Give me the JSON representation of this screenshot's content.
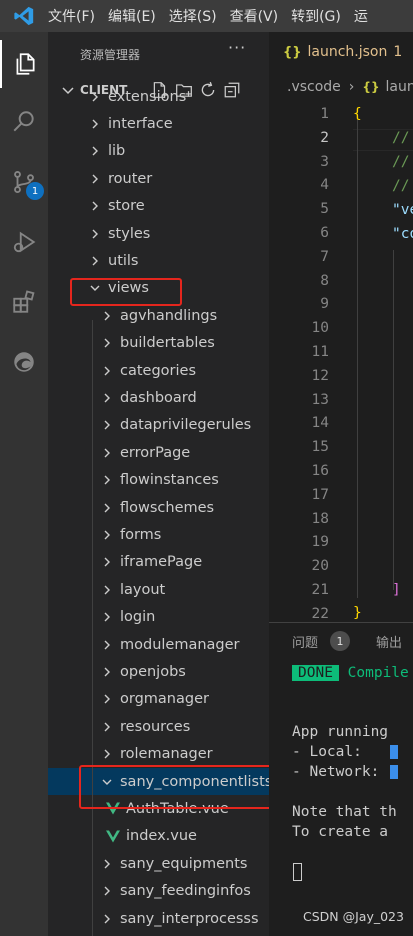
{
  "titlebar": {
    "logo_icon": "vscode-logo-icon",
    "menu": [
      "文件(F)",
      "编辑(E)",
      "选择(S)",
      "查看(V)",
      "转到(G)",
      "运"
    ]
  },
  "activity": {
    "scm_badge": "1"
  },
  "sidebar": {
    "title": "资源管理器",
    "more": "···",
    "root": "CLIENT",
    "tree": [
      {
        "label": "extensions",
        "type": "folder-collapsed"
      },
      {
        "label": "interface",
        "type": "folder-collapsed"
      },
      {
        "label": "lib",
        "type": "folder-collapsed"
      },
      {
        "label": "router",
        "type": "folder-collapsed"
      },
      {
        "label": "store",
        "type": "folder-collapsed"
      },
      {
        "label": "styles",
        "type": "folder-collapsed"
      },
      {
        "label": "utils",
        "type": "folder-collapsed"
      },
      {
        "label": "views",
        "type": "folder-expanded"
      },
      {
        "label": "agvhandlings",
        "type": "folder-collapsed"
      },
      {
        "label": "buildertables",
        "type": "folder-collapsed"
      },
      {
        "label": "categories",
        "type": "folder-collapsed"
      },
      {
        "label": "dashboard",
        "type": "folder-collapsed"
      },
      {
        "label": "dataprivilegerules",
        "type": "folder-collapsed"
      },
      {
        "label": "errorPage",
        "type": "folder-collapsed"
      },
      {
        "label": "flowinstances",
        "type": "folder-collapsed"
      },
      {
        "label": "flowschemes",
        "type": "folder-collapsed"
      },
      {
        "label": "forms",
        "type": "folder-collapsed"
      },
      {
        "label": "iframePage",
        "type": "folder-collapsed"
      },
      {
        "label": "layout",
        "type": "folder-collapsed"
      },
      {
        "label": "login",
        "type": "folder-collapsed"
      },
      {
        "label": "modulemanager",
        "type": "folder-collapsed"
      },
      {
        "label": "openjobs",
        "type": "folder-collapsed"
      },
      {
        "label": "orgmanager",
        "type": "folder-collapsed"
      },
      {
        "label": "resources",
        "type": "folder-collapsed"
      },
      {
        "label": "rolemanager",
        "type": "folder-collapsed"
      },
      {
        "label": "sany_componentlists",
        "type": "folder-expanded"
      },
      {
        "label": "AuthTable.vue",
        "type": "vue-file"
      },
      {
        "label": "index.vue",
        "type": "vue-file"
      },
      {
        "label": "sany_equipments",
        "type": "folder-collapsed"
      },
      {
        "label": "sany_feedinginfos",
        "type": "folder-collapsed"
      },
      {
        "label": "sany_interprocesss",
        "type": "folder-collapsed"
      }
    ]
  },
  "editor": {
    "tab_icon": "{}",
    "tab_name": "launch.json",
    "tab_modified": "1",
    "breadcrumb": [
      ".vscode",
      "laun"
    ],
    "line_numbers": [
      "1",
      "2",
      "3",
      "4",
      "5",
      "6",
      "7",
      "8",
      "9",
      "10",
      "11",
      "12",
      "13",
      "14",
      "15",
      "16",
      "17",
      "18",
      "19",
      "20",
      "21",
      "22"
    ],
    "code": {
      "l1": "{",
      "l2": "//",
      "l3": "//",
      "l4": "//",
      "l5": "\"ve",
      "l6": "\"co",
      "l21": "]",
      "l22": "}"
    }
  },
  "panel": {
    "tab_problems": "问题",
    "problems_count": "1",
    "tab_output": "输出",
    "done": "DONE",
    "compiled": "Compile",
    "line1": "App running",
    "line2": "- Local:   ",
    "line3": "- Network: ",
    "line4": "Note that th",
    "line5": "To create a"
  },
  "watermark": "CSDN @Jay_023"
}
